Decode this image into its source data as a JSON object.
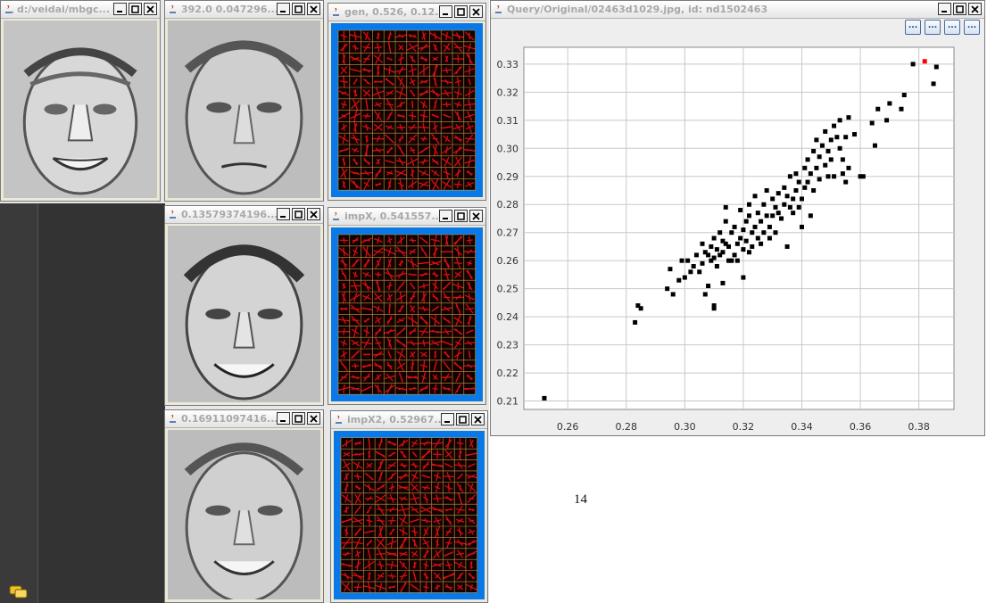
{
  "windows": {
    "w1": {
      "title": "d:/veidai/mbgc..."
    },
    "w2": {
      "title": "392.0 0.047296..."
    },
    "w3": {
      "title": "gen, 0.526, 0.12..."
    },
    "w4": {
      "title": "0.13579374196..."
    },
    "w5": {
      "title": "impX, 0.541557..."
    },
    "w6": {
      "title": "0.16911097416..."
    },
    "w7": {
      "title": "impX2, 0.52967..."
    }
  },
  "plot_window": {
    "title": "Query/Original/02463d1029.jpg, id: nd1502463",
    "buttons": [
      "...",
      "...",
      "...",
      "..."
    ]
  },
  "page_number": "14",
  "colors": {
    "grid_bg": "#0a78e6",
    "highlight_point": "#ff0000",
    "point": "#000000"
  },
  "chart_data": {
    "type": "scatter",
    "xlim": [
      0.245,
      0.392
    ],
    "ylim": [
      0.207,
      0.336
    ],
    "x_ticks": [
      "0.26",
      "0.28",
      "0.30",
      "0.32",
      "0.34",
      "0.36",
      "0.38"
    ],
    "y_ticks": [
      "0.21",
      "0.22",
      "0.23",
      "0.24",
      "0.25",
      "0.26",
      "0.27",
      "0.28",
      "0.29",
      "0.30",
      "0.31",
      "0.32",
      "0.33"
    ],
    "grid": true,
    "highlight": [
      0.382,
      0.331
    ],
    "points": [
      [
        0.252,
        0.211
      ],
      [
        0.283,
        0.238
      ],
      [
        0.284,
        0.244
      ],
      [
        0.285,
        0.243
      ],
      [
        0.294,
        0.25
      ],
      [
        0.295,
        0.257
      ],
      [
        0.296,
        0.248
      ],
      [
        0.298,
        0.253
      ],
      [
        0.299,
        0.26
      ],
      [
        0.3,
        0.254
      ],
      [
        0.301,
        0.26
      ],
      [
        0.302,
        0.256
      ],
      [
        0.303,
        0.258
      ],
      [
        0.304,
        0.262
      ],
      [
        0.305,
        0.256
      ],
      [
        0.306,
        0.259
      ],
      [
        0.306,
        0.266
      ],
      [
        0.307,
        0.263
      ],
      [
        0.307,
        0.248
      ],
      [
        0.308,
        0.251
      ],
      [
        0.308,
        0.262
      ],
      [
        0.309,
        0.26
      ],
      [
        0.309,
        0.265
      ],
      [
        0.31,
        0.261
      ],
      [
        0.31,
        0.268
      ],
      [
        0.31,
        0.243
      ],
      [
        0.31,
        0.244
      ],
      [
        0.311,
        0.264
      ],
      [
        0.311,
        0.258
      ],
      [
        0.312,
        0.262
      ],
      [
        0.312,
        0.27
      ],
      [
        0.313,
        0.263
      ],
      [
        0.313,
        0.267
      ],
      [
        0.313,
        0.252
      ],
      [
        0.314,
        0.266
      ],
      [
        0.314,
        0.274
      ],
      [
        0.314,
        0.279
      ],
      [
        0.315,
        0.26
      ],
      [
        0.315,
        0.265
      ],
      [
        0.316,
        0.27
      ],
      [
        0.316,
        0.26
      ],
      [
        0.317,
        0.262
      ],
      [
        0.317,
        0.272
      ],
      [
        0.318,
        0.266
      ],
      [
        0.318,
        0.26
      ],
      [
        0.319,
        0.278
      ],
      [
        0.319,
        0.268
      ],
      [
        0.32,
        0.264
      ],
      [
        0.32,
        0.271
      ],
      [
        0.32,
        0.254
      ],
      [
        0.321,
        0.274
      ],
      [
        0.321,
        0.267
      ],
      [
        0.322,
        0.276
      ],
      [
        0.322,
        0.263
      ],
      [
        0.322,
        0.28
      ],
      [
        0.323,
        0.27
      ],
      [
        0.323,
        0.265
      ],
      [
        0.324,
        0.272
      ],
      [
        0.324,
        0.283
      ],
      [
        0.325,
        0.268
      ],
      [
        0.325,
        0.277
      ],
      [
        0.326,
        0.274
      ],
      [
        0.326,
        0.266
      ],
      [
        0.327,
        0.28
      ],
      [
        0.327,
        0.27
      ],
      [
        0.328,
        0.276
      ],
      [
        0.328,
        0.285
      ],
      [
        0.329,
        0.272
      ],
      [
        0.329,
        0.268
      ],
      [
        0.33,
        0.282
      ],
      [
        0.33,
        0.276
      ],
      [
        0.331,
        0.279
      ],
      [
        0.331,
        0.27
      ],
      [
        0.332,
        0.284
      ],
      [
        0.332,
        0.277
      ],
      [
        0.333,
        0.275
      ],
      [
        0.334,
        0.28
      ],
      [
        0.334,
        0.286
      ],
      [
        0.335,
        0.265
      ],
      [
        0.335,
        0.283
      ],
      [
        0.336,
        0.279
      ],
      [
        0.336,
        0.29
      ],
      [
        0.337,
        0.282
      ],
      [
        0.337,
        0.277
      ],
      [
        0.338,
        0.285
      ],
      [
        0.338,
        0.291
      ],
      [
        0.339,
        0.279
      ],
      [
        0.339,
        0.288
      ],
      [
        0.34,
        0.282
      ],
      [
        0.34,
        0.272
      ],
      [
        0.341,
        0.293
      ],
      [
        0.341,
        0.286
      ],
      [
        0.342,
        0.296
      ],
      [
        0.342,
        0.288
      ],
      [
        0.343,
        0.291
      ],
      [
        0.343,
        0.276
      ],
      [
        0.344,
        0.299
      ],
      [
        0.344,
        0.285
      ],
      [
        0.345,
        0.293
      ],
      [
        0.345,
        0.303
      ],
      [
        0.346,
        0.289
      ],
      [
        0.346,
        0.297
      ],
      [
        0.347,
        0.301
      ],
      [
        0.348,
        0.294
      ],
      [
        0.348,
        0.306
      ],
      [
        0.349,
        0.29
      ],
      [
        0.349,
        0.299
      ],
      [
        0.35,
        0.303
      ],
      [
        0.35,
        0.296
      ],
      [
        0.351,
        0.308
      ],
      [
        0.351,
        0.29
      ],
      [
        0.352,
        0.304
      ],
      [
        0.353,
        0.3
      ],
      [
        0.353,
        0.31
      ],
      [
        0.354,
        0.296
      ],
      [
        0.354,
        0.291
      ],
      [
        0.355,
        0.304
      ],
      [
        0.355,
        0.288
      ],
      [
        0.356,
        0.311
      ],
      [
        0.356,
        0.293
      ],
      [
        0.358,
        0.305
      ],
      [
        0.36,
        0.29
      ],
      [
        0.361,
        0.29
      ],
      [
        0.364,
        0.309
      ],
      [
        0.365,
        0.301
      ],
      [
        0.366,
        0.314
      ],
      [
        0.369,
        0.31
      ],
      [
        0.37,
        0.316
      ],
      [
        0.374,
        0.314
      ],
      [
        0.375,
        0.319
      ],
      [
        0.378,
        0.33
      ],
      [
        0.385,
        0.323
      ],
      [
        0.386,
        0.329
      ]
    ]
  }
}
